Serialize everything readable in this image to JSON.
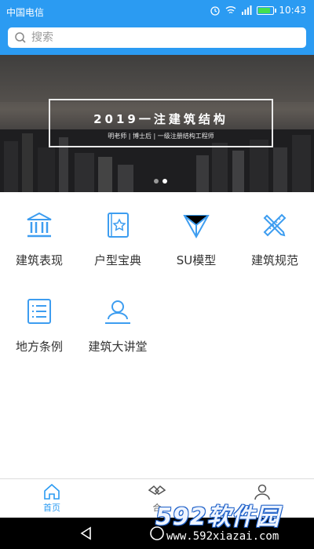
{
  "status_bar": {
    "carrier": "中国电信",
    "time": "10:43"
  },
  "search": {
    "placeholder": "搜索"
  },
  "banner": {
    "title": "2019一注建筑结构",
    "subtitle": "明老师 | 博士后 | 一级注册结构工程师",
    "slides": 2,
    "active_slide": 2
  },
  "menu": {
    "items": [
      {
        "label": "建筑表现",
        "icon": "bank-building-icon"
      },
      {
        "label": "户型宝典",
        "icon": "star-book-icon"
      },
      {
        "label": "SU模型",
        "icon": "triangle-model-icon"
      },
      {
        "label": "建筑规范",
        "icon": "ruler-pencil-icon"
      },
      {
        "label": "地方条例",
        "icon": "document-list-icon"
      },
      {
        "label": "建筑大讲堂",
        "icon": "lecturer-person-icon"
      }
    ]
  },
  "bottom_nav": {
    "tabs": [
      {
        "label": "首页",
        "icon": "home-icon",
        "active": true
      },
      {
        "label": "合",
        "icon": "handshake-icon",
        "active": false
      },
      {
        "label": "",
        "icon": "person-icon",
        "active": false
      }
    ]
  },
  "watermark": {
    "brand": "592软件园",
    "url": "www.592xiazai.com"
  },
  "colors": {
    "accent": "#2b9bf2",
    "icon_blue": "#3d9df0"
  }
}
